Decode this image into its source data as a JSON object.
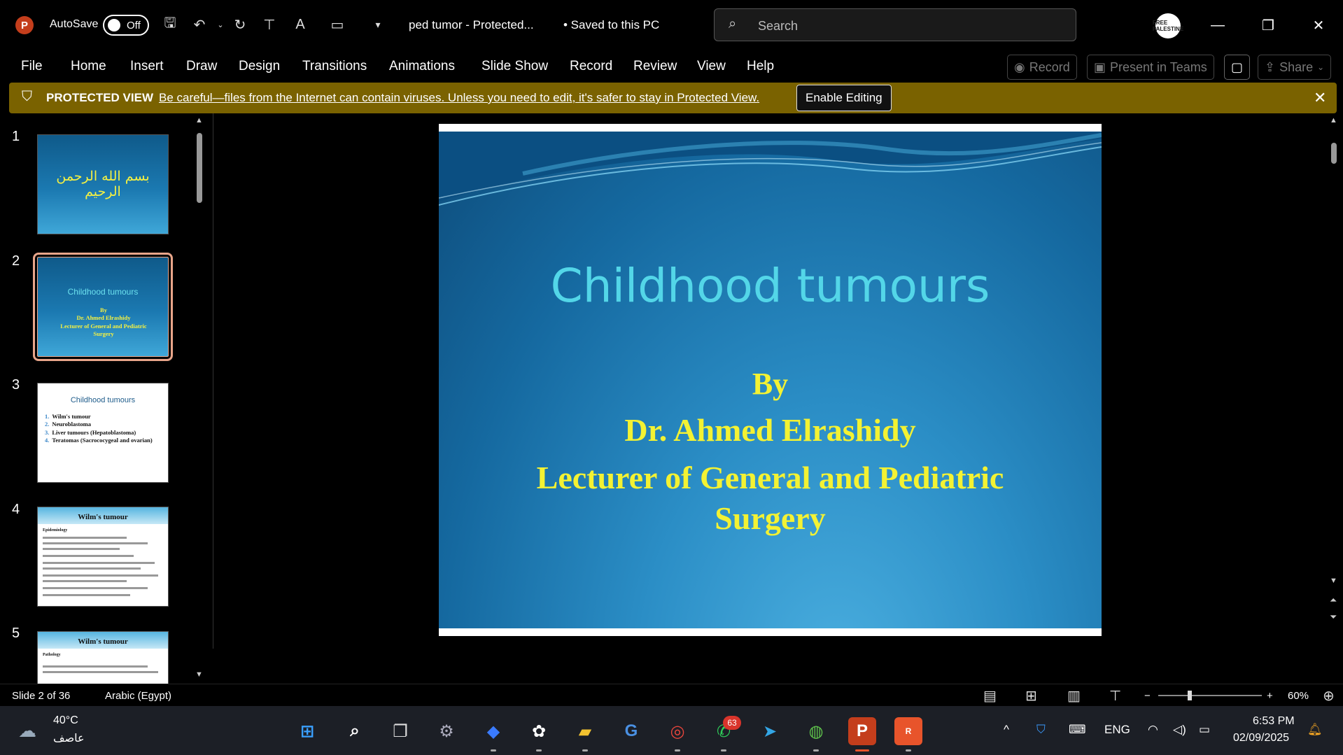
{
  "titlebar": {
    "app_logo": "P",
    "autosave_label": "AutoSave",
    "autosave_state": "Off",
    "doc_title": "ped tumor  -  Protected...",
    "saved_status": "•  Saved to this PC",
    "search_placeholder": "Search",
    "profile_text": "FREE PALESTINE"
  },
  "ribbon": {
    "tabs": [
      "File",
      "Home",
      "Insert",
      "Draw",
      "Design",
      "Transitions",
      "Animations",
      "Slide Show",
      "Record",
      "Review",
      "View",
      "Help"
    ],
    "record_btn": "Record",
    "teams_btn": "Present in Teams",
    "share_btn": "Share"
  },
  "protected": {
    "title": "PROTECTED VIEW",
    "message": "Be careful—files from the Internet can contain viruses. Unless you need to edit, it's safer to stay in Protected View.",
    "enable_btn": "Enable Editing"
  },
  "thumbnails": [
    {
      "num": "1",
      "text": "بسم الله الرحمن الرحيم"
    },
    {
      "num": "2",
      "title": "Childhood tumours",
      "sub": [
        "By",
        "Dr. Ahmed Elrashidy",
        "Lecturer of General and Pediatric",
        "Surgery"
      ]
    },
    {
      "num": "3",
      "title": "Childhood tumours",
      "items": [
        "Wilm's tumour",
        "Neuroblastoma",
        "Liver tumours   (Hepatoblastoma)",
        "Teratomas   (Sacrococygeal and ovarian)"
      ]
    },
    {
      "num": "4",
      "title": "Wilm's tumour",
      "sub": "Epidemiology"
    },
    {
      "num": "5",
      "title": "Wilm's tumour",
      "sub": "Pathology"
    }
  ],
  "slide": {
    "title": "Childhood tumours",
    "by": "By",
    "author": "Dr. Ahmed Elrashidy",
    "role_line1": "Lecturer of General and Pediatric",
    "role_line2": "Surgery"
  },
  "status": {
    "slide_info": "Slide 2 of 36",
    "language": "Arabic (Egypt)",
    "zoom": "60%"
  },
  "taskbar": {
    "weather_temp": "40°C",
    "weather_desc": "عاصف",
    "whatsapp_badge": "63",
    "lang": "ENG",
    "time": "6:53 PM",
    "date": "02/09/2025"
  }
}
